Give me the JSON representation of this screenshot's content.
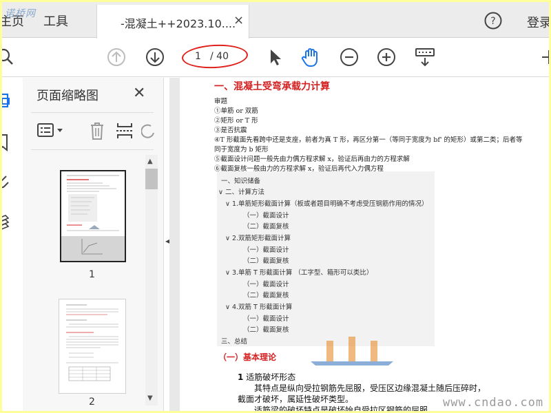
{
  "tabs": {
    "home": "主页",
    "tools": "工具",
    "doc_title": "-混凝土++2023.10....",
    "close": "×"
  },
  "header": {
    "login": "登录",
    "watermark": "诺桥网"
  },
  "toolbar": {
    "current_page": "1",
    "total_pages": "/ 40"
  },
  "panel": {
    "title": "页面缩略图",
    "close": "✕",
    "thumb_labels": [
      "1",
      "2"
    ]
  },
  "document": {
    "heading": "一、混凝土受弯承载力计算",
    "lines": [
      "审题",
      "①单筋 or 双筋",
      "②矩形 or  T 形",
      "③是否抗震",
      "④T 形截面先看跨中还是支座，前者为真 T 形，再区分第一（等同于宽度为 bf' 的矩形）或第二类；后者等",
      "同于宽度为 b 矩形",
      "⑤截面设计问题一般先由力偶方程求解 x，验证后再由力的方程求解",
      "⑥截面复核一般由力的方程求解 x，验证后再代入力偶方程"
    ],
    "toc": [
      "一、知识储备",
      "∨ 二、计算方法",
      "∨ 1.单筋矩形截面计算（板或者题目明确不考虑受压钢筋作用的情况）",
      "（一）截面设计",
      "（二）截面复核",
      "∨ 2.双筋矩形截面计算",
      "（一）截面设计",
      "（二）截面复核",
      "∨ 3.单筋 T 形截面计算  （工字型、箱形可以类比）",
      "（一）截面设计",
      "（二）截面复核",
      "∨ 4.双筋 T 形截面计算",
      "（一）截面设计",
      "（二）截面复核",
      "三、总结"
    ],
    "section2": "（一）基本理论",
    "section3_num": "1",
    "section3_text": "适筋破坏形态",
    "body1": "其特点是纵向受拉钢筋先屈服，受压区边缘混凝土随后压碎时，",
    "body2": "截面才破坏，属延性破坏类型。",
    "body3": "适筋梁的破坏特点是破坏始自受拉区钢筋的屈服。"
  },
  "footer": {
    "watermark": "www.cndao.com"
  },
  "colors": {
    "accent_red": "#d42020",
    "icon_blue": "#1a73e8",
    "frame_yellow": "#ffff99"
  }
}
